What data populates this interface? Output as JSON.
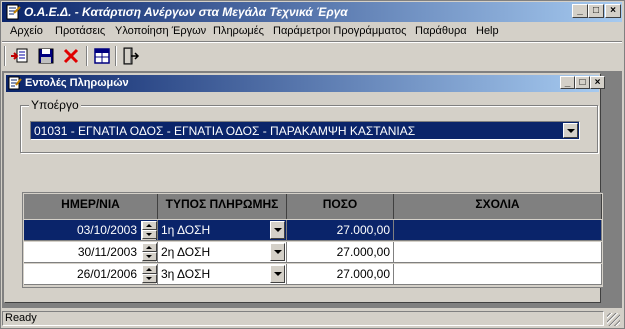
{
  "app": {
    "title": "Ο.Α.Ε.Δ. - Κατάρτιση Ανέργων στα Μεγάλα Τεχνικά Έργα"
  },
  "menu": [
    {
      "label": "Αρχείο"
    },
    {
      "label": "Προτάσεις"
    },
    {
      "label": "Υλοποίηση Έργων"
    },
    {
      "label": "Πληρωμές"
    },
    {
      "label": "Παράμετροι Προγράμματος"
    },
    {
      "label": "Παράθυρα"
    },
    {
      "label": "Help"
    }
  ],
  "toolbar": [
    {
      "icon": "add-record-icon"
    },
    {
      "icon": "save-icon"
    },
    {
      "icon": "delete-icon"
    },
    {
      "icon": "grid-icon"
    },
    {
      "icon": "exit-icon"
    }
  ],
  "child": {
    "title": "Εντολές Πληρωμών",
    "group_label": "Υποέργο",
    "subproject_value": "01031 - ΕΓΝΑΤΙΑ ΟΔΟΣ - ΕΓΝΑΤΙΑ ΟΔΟΣ - ΠΑΡΑΚΑΜΨΗ ΚΑΣΤΑΝΙΑΣ"
  },
  "grid": {
    "columns": [
      "ΗΜΕΡ/ΝΙΑ",
      "ΤΥΠΟΣ ΠΛΗΡΩΜΗΣ",
      "ΠΟΣΟ",
      "ΣΧΟΛΙΑ"
    ],
    "rows": [
      {
        "date": "03/10/2003",
        "type": "1η ΔΟΣΗ",
        "amount": "27.000,00",
        "comment": ""
      },
      {
        "date": "30/11/2003",
        "type": "2η ΔΟΣΗ",
        "amount": "27.000,00",
        "comment": ""
      },
      {
        "date": "26/01/2006",
        "type": "3η ΔΟΣΗ",
        "amount": "27.000,00",
        "comment": ""
      }
    ]
  },
  "status": {
    "text": "Ready"
  },
  "colors": {
    "selection": "#0a246a",
    "face": "#d4d0c8",
    "header": "#808080"
  }
}
